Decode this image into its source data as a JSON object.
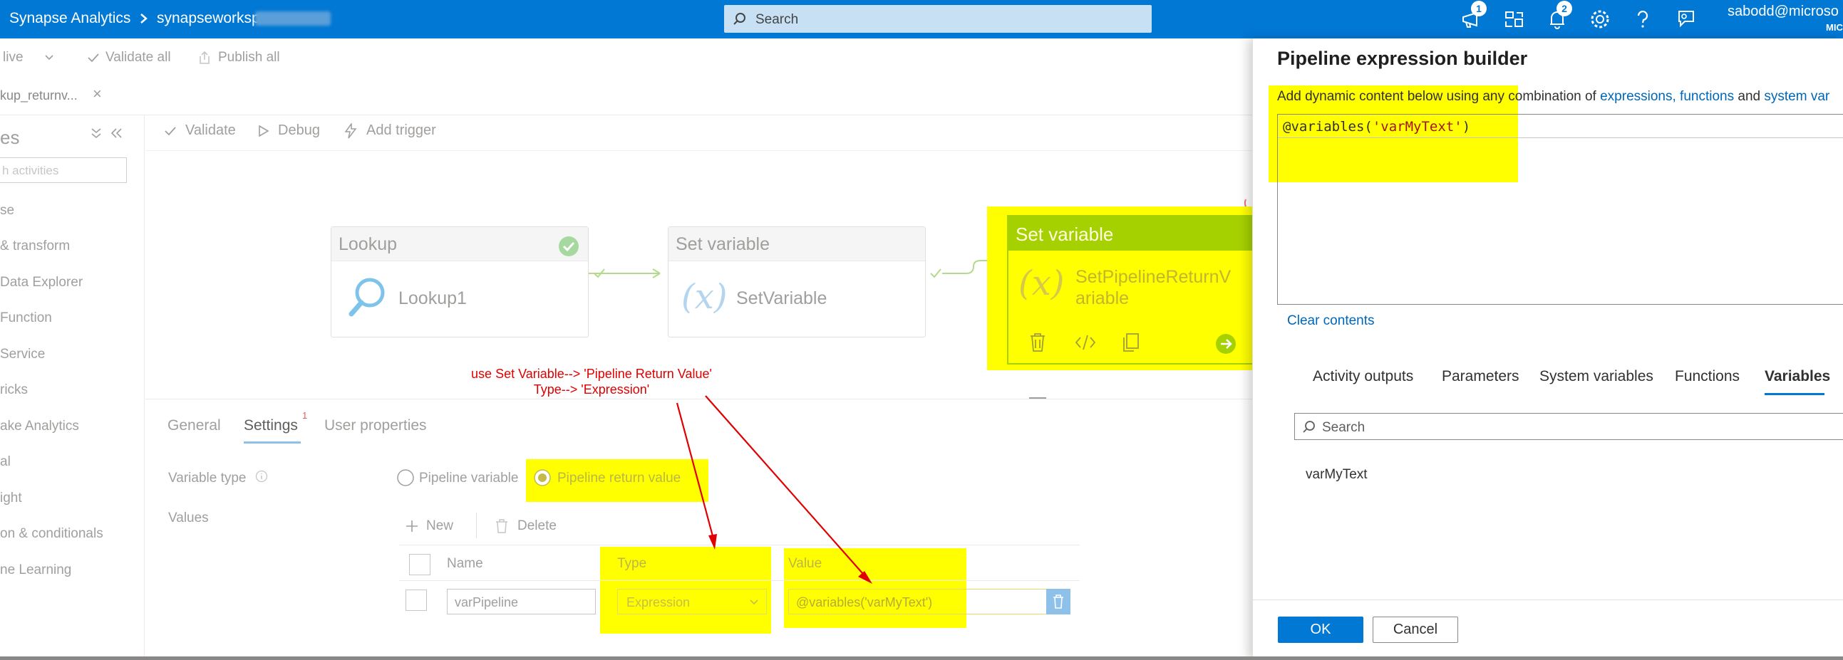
{
  "topbar": {
    "brand": "Synapse Analytics",
    "workspace": "synapseworksp",
    "search_placeholder": "Search",
    "feedback_badge": "1",
    "notifications_badge": "2",
    "user_name": "sabodd@microso",
    "user_org": "MIC"
  },
  "commands": {
    "live": "live",
    "validate_all": "Validate all",
    "publish_all": "Publish all"
  },
  "tab": {
    "pipeline_name": "kup_returnv..."
  },
  "sidebar": {
    "title": "es",
    "search_placeholder": "h activities",
    "items": [
      "se",
      "& transform",
      "Data Explorer",
      "Function",
      "Service",
      "ricks",
      "ake Analytics",
      "al",
      "ight",
      "on & conditionals",
      "ne Learning"
    ]
  },
  "canvas_toolbar": {
    "validate": "Validate",
    "debug": "Debug",
    "add_trigger": "Add trigger"
  },
  "activities": [
    {
      "type": "Lookup",
      "name": "Lookup1"
    },
    {
      "type": "Set variable",
      "name": "SetVariable"
    },
    {
      "type": "Set variable",
      "name_line1": "SetPipelineReturnV",
      "name_line2": "ariable"
    }
  ],
  "props": {
    "tabs": [
      "General",
      "Settings",
      "User properties"
    ],
    "settings_badge": "1",
    "variable_type_label": "Variable type",
    "option_pipeline_variable": "Pipeline variable",
    "option_pipeline_return": "Pipeline return value",
    "values_label": "Values",
    "new": "New",
    "delete": "Delete",
    "col_name": "Name",
    "col_type": "Type",
    "col_value": "Value",
    "row_name": "varPipeline",
    "row_type": "Expression",
    "row_value": "@variables('varMyText')"
  },
  "annotation": {
    "line1": "use Set Variable--> 'Pipeline Return Value'",
    "line2": "Type--> 'Expression'"
  },
  "panel": {
    "title": "Pipeline expression builder",
    "desc_prefix": "Add dynamic content below using any combination of ",
    "desc_link1": "expressions, functions",
    "desc_and": " and ",
    "desc_link2": "system var",
    "expr_prefix": "@variables(",
    "expr_string": "'varMyText'",
    "expr_suffix": ")",
    "clear_contents": "Clear contents",
    "tabs": [
      "Activity outputs",
      "Parameters",
      "System variables",
      "Functions",
      "Variables"
    ],
    "search_placeholder": "Search",
    "variable_item": "varMyText",
    "ok": "OK",
    "cancel": "Cancel"
  },
  "colors": {
    "brand": "#0078d4",
    "highlight": "#ffff00",
    "annotation": "#e00000",
    "activity_green": "#a6d100"
  }
}
